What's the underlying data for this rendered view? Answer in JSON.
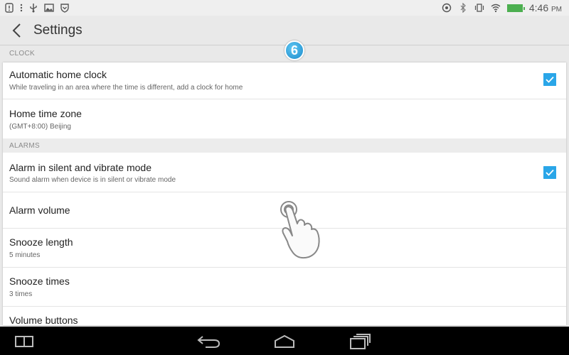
{
  "status_bar": {
    "time": "4:46",
    "ampm": "PM",
    "icons_left": [
      "notification-icon",
      "usb-icon",
      "image-icon",
      "shield-icon"
    ],
    "icons_right": [
      "sync-icon",
      "bluetooth-icon",
      "vibrate-icon",
      "wifi-icon",
      "battery-icon"
    ],
    "battery_color": "#4caf50"
  },
  "header": {
    "title": "Settings"
  },
  "step_badge": "6",
  "sections": {
    "clock": "CLOCK",
    "alarms": "ALARMS"
  },
  "settings": {
    "automatic_home_clock": {
      "title": "Automatic home clock",
      "subtitle": "While traveling in an area where the time is different, add a clock for home",
      "checked": true
    },
    "home_time_zone": {
      "title": "Home time zone",
      "subtitle": "(GMT+8:00) Beijing"
    },
    "alarm_silent": {
      "title": "Alarm in silent and vibrate mode",
      "subtitle": "Sound alarm when device is in silent or vibrate mode",
      "checked": true
    },
    "alarm_volume": {
      "title": "Alarm volume"
    },
    "snooze_length": {
      "title": "Snooze length",
      "subtitle": "5 minutes"
    },
    "snooze_times": {
      "title": "Snooze times",
      "subtitle": "3 times"
    },
    "volume_buttons": {
      "title": "Volume buttons"
    }
  },
  "colors": {
    "accent": "#2aa6e8",
    "badge": "#1c8ccc"
  },
  "nav_bar": [
    "multiwindow-icon",
    "back-icon",
    "home-icon",
    "recents-icon"
  ]
}
